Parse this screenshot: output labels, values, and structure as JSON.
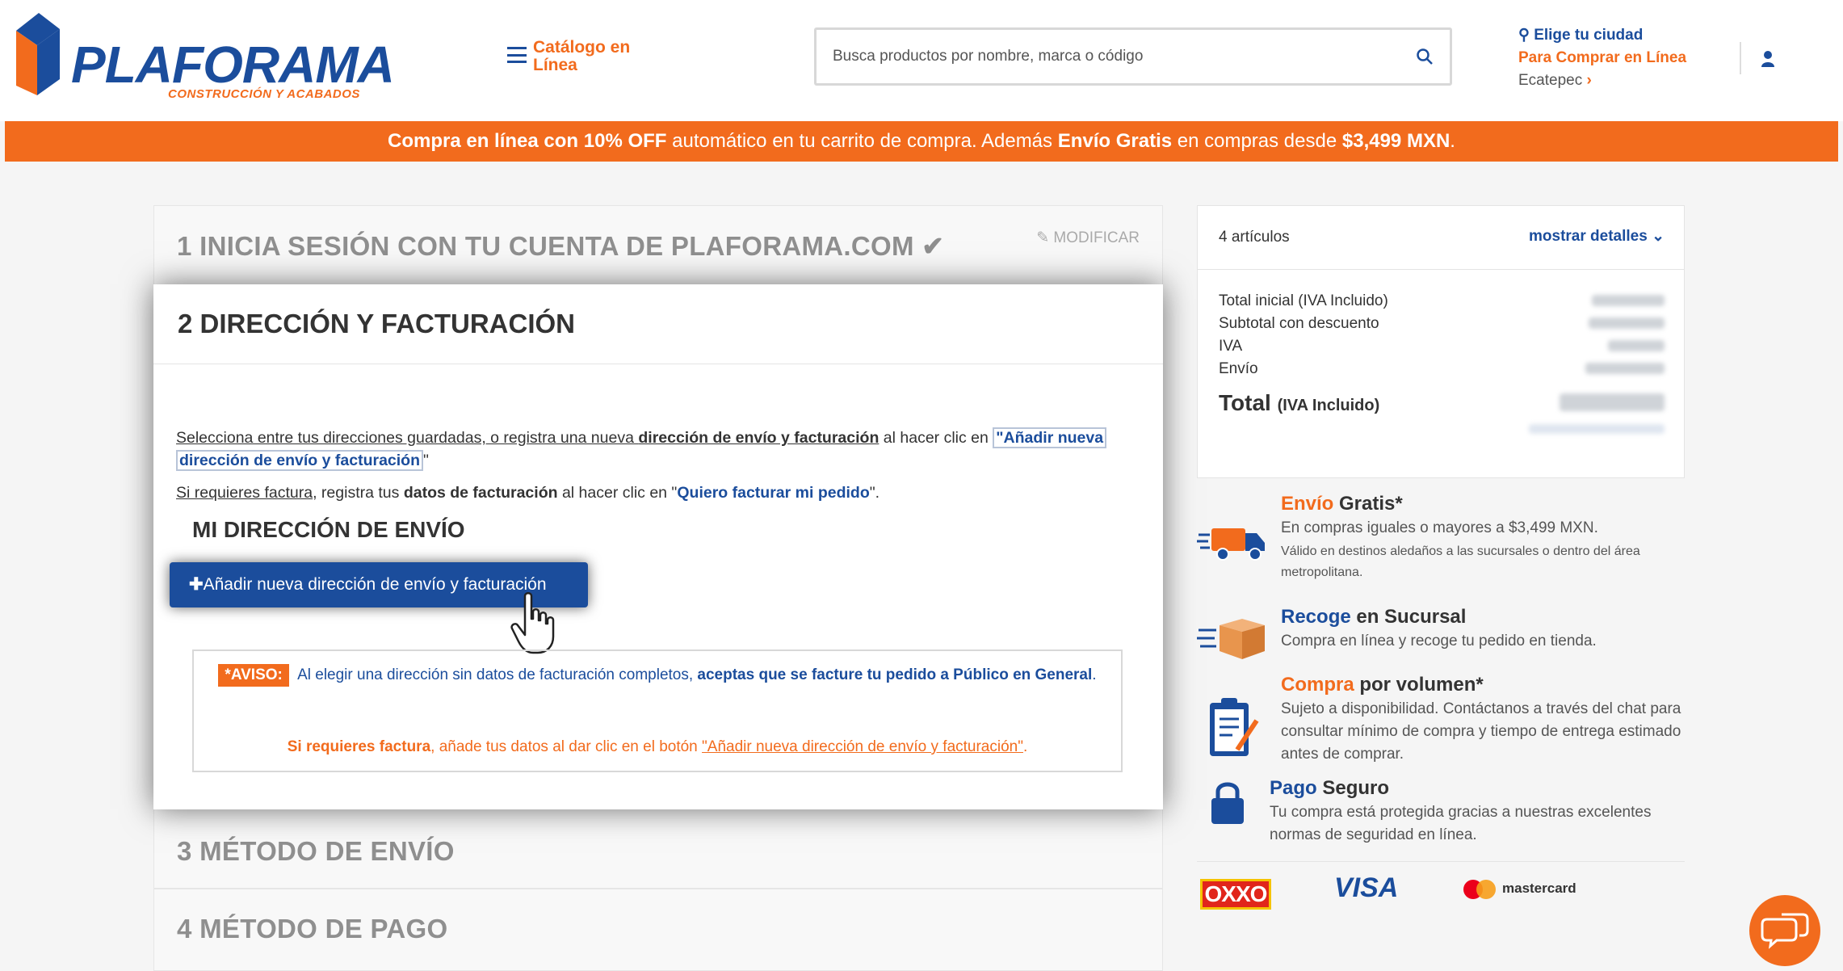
{
  "header": {
    "logo_text": "PLAFORAMA",
    "logo_tagline": "CONSTRUCCIÓN Y ACABADOS",
    "catalog_label": "Catálogo en Línea",
    "search_placeholder": "Busca productos por nombre, marca o código",
    "city_title": "Elige tu ciudad",
    "city_subtitle": "Para Comprar en Línea",
    "city_value": "Ecatepec"
  },
  "banner": {
    "p1": "Compra en línea con 10% OFF",
    "p2": " automático en tu carrito de compra. Además ",
    "p3": "Envío Gratis",
    "p4": " en compras desde ",
    "p5": "$3,499 MXN",
    "p6": "."
  },
  "steps": {
    "step1_title": "1 INICIA SESIÓN CON TU CUENTA DE PLAFORAMA.COM",
    "step1_modify": "MODIFICAR",
    "step2_title": "2 DIRECCIÓN Y FACTURACIÓN",
    "step3_title": "3 MÉTODO DE ENVÍO",
    "step4_title": "4 MÉTODO DE PAGO"
  },
  "address": {
    "intro_a": "Selecciona entre tus direcciones guardadas, o registra una nueva ",
    "intro_b": "dirección de envío y facturación",
    "intro_c": " al hacer clic en ",
    "intro_link1": "\"Añadir nueva",
    "intro_link2": "dirección de envío y facturación",
    "intro_end": "\"",
    "invoice_a": "Si requieres factura",
    "invoice_b": ", registra tus ",
    "invoice_c": "datos de facturación",
    "invoice_d": " al hacer clic en \"",
    "invoice_link": "Quiero facturar mi pedido",
    "invoice_e": "\".",
    "section_title": "MI DIRECCIÓN DE ENVÍO",
    "add_button": "Añadir nueva dirección de envío y facturación",
    "notice_badge": "*AVISO:",
    "notice_a": " Al elegir una dirección sin datos de facturación completos, ",
    "notice_b": "aceptas que se facture tu pedido a Público en General",
    "notice_c": ".",
    "notice2_a": "Si requieres factura",
    "notice2_b": ", añade tus datos al dar clic en el botón ",
    "notice2_link": "\"Añadir nueva dirección de envío y facturación\"",
    "notice2_c": "."
  },
  "summary": {
    "count": "4 artículos",
    "show_details": "mostrar detalles",
    "row_initial": "Total inicial (IVA Incluido)",
    "row_subtotal": "Subtotal con descuento",
    "row_iva": "IVA",
    "row_shipping": "Envío",
    "total_label": "Total",
    "total_note": "(IVA Incluido)"
  },
  "benefits": {
    "free_o": "Envío",
    "free_d": " Gratis*",
    "free_t1": "En compras iguales o mayores a $3,499 MXN.",
    "free_t2": "Válido en destinos aledaños a las sucursales o dentro del área metropolitana.",
    "pickup_b": "Recoge",
    "pickup_d": " en Sucursal",
    "pickup_t": "Compra en línea y recoge tu pedido en tienda.",
    "volume_o": "Compra",
    "volume_d": " por volumen*",
    "volume_t": "Sujeto a disponibilidad. Contáctanos a través del chat para consultar mínimo de compra y tiempo de entrega estimado antes de comprar.",
    "secure_b": "Pago",
    "secure_d": " Seguro",
    "secure_t": "Tu compra está protegida gracias a nuestras excelentes normas de seguridad en línea."
  },
  "payments": {
    "oxxo": "OXXO",
    "visa": "VISA",
    "mastercard": "mastercard"
  },
  "colors": {
    "brand_blue": "#1b4d9c",
    "brand_orange": "#f26b1d"
  }
}
